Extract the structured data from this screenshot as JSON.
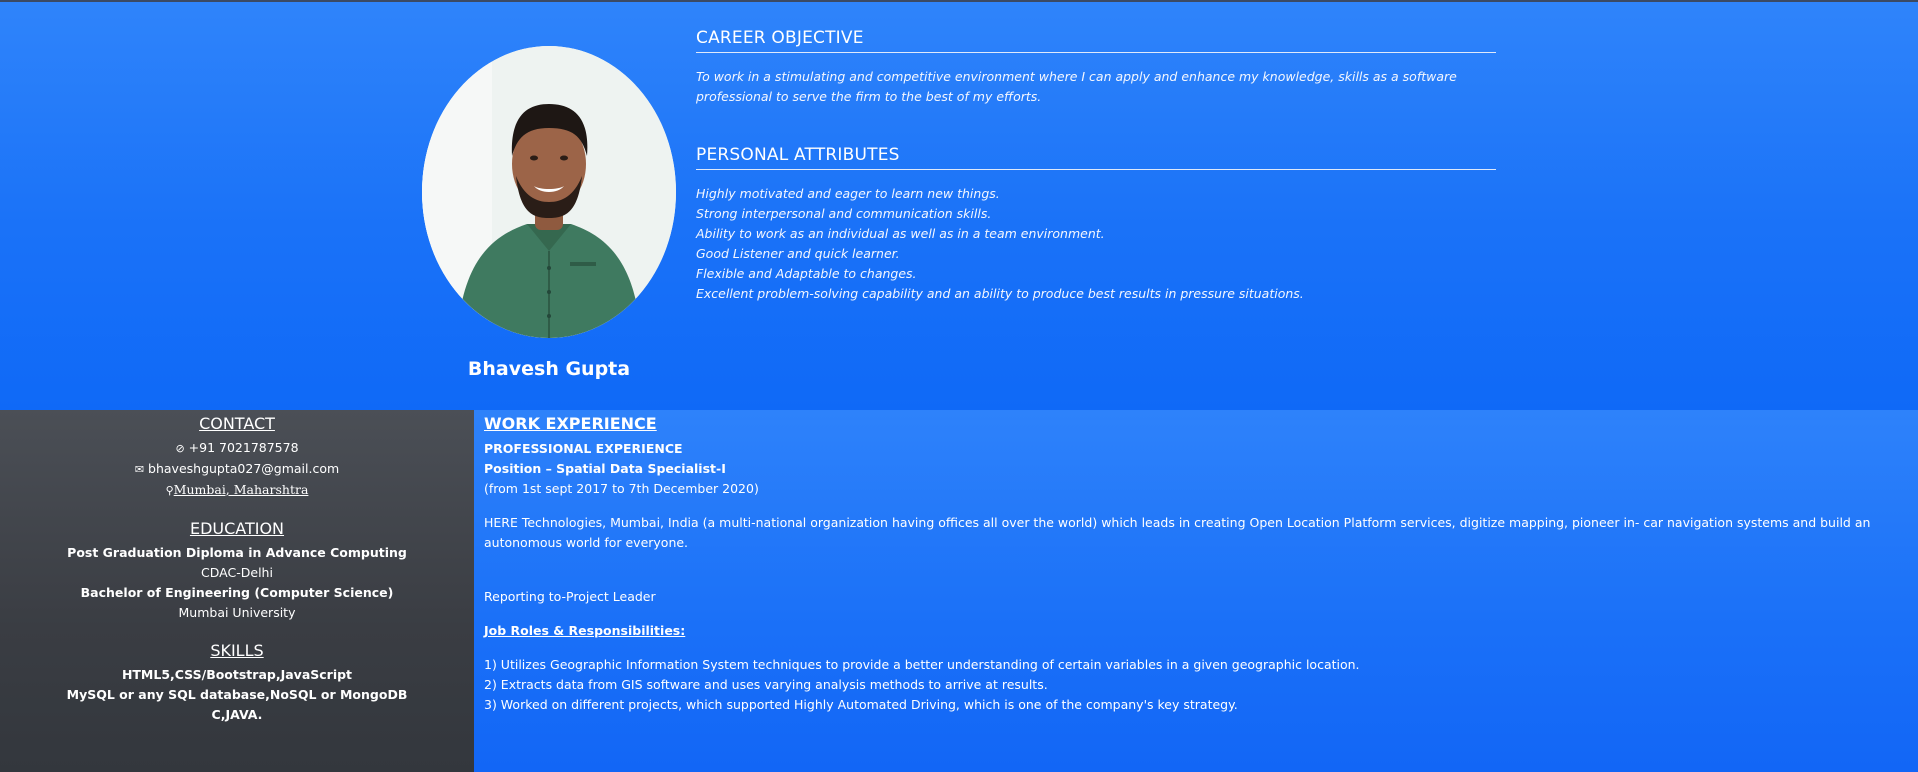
{
  "profile": {
    "name": "Bhavesh Gupta"
  },
  "career": {
    "title": "CAREER OBJECTIVE",
    "text": "To work in a stimulating and competitive environment where I can apply and enhance my knowledge, skills as a software professional to serve the firm to the best of my efforts."
  },
  "attributes": {
    "title": "PERSONAL ATTRIBUTES",
    "items": [
      "Highly motivated and eager to learn new things.",
      "Strong interpersonal and communication skills.",
      "Ability to work as an individual as well as in a team environment.",
      "Good Listener and quick learner.",
      "Flexible and Adaptable to changes.",
      "Excellent problem-solving capability and an ability to produce best results in pressure situations."
    ]
  },
  "contact": {
    "title": "CONTACT",
    "phone": "+91 7021787578",
    "email": "bhaveshgupta027@gmail.com",
    "location": "Mumbai, Maharshtra"
  },
  "education": {
    "title": "EDUCATION",
    "degree1": "Post Graduation Diploma in Advance Computing",
    "school1": "CDAC-Delhi",
    "degree2": "Bachelor of Engineering (Computer Science)",
    "school2": "Mumbai University"
  },
  "skills": {
    "title": "SKILLS",
    "items": [
      "HTML5,CSS/Bootstrap,JavaScript",
      "MySQL or any SQL database,NoSQL or MongoDB",
      "C,JAVA."
    ]
  },
  "work": {
    "title": "WORK EXPERIENCE",
    "subtitle": "PROFESSIONAL EXPERIENCE",
    "position": "Position – Spatial Data Specialist-I",
    "period": "(from 1st sept 2017 to 7th December 2020)",
    "company_desc": "HERE Technologies, Mumbai, India (a multi-national organization having offices all over the world) which leads in creating Open Location Platform services, digitize mapping, pioneer in- car navigation systems and build an autonomous world for everyone.",
    "reporting": "Reporting to-Project Leader",
    "roles_title": "Job Roles & Responsibilities:",
    "roles": [
      "1) Utilizes Geographic Information System techniques to provide a better understanding of certain variables in a given geographic location.",
      "2) Extracts data from GIS software and uses varying analysis methods to arrive at results.",
      "3) Worked on different projects, which supported Highly Automated Driving, which is one of the company's key strategy."
    ]
  },
  "icons": {
    "phone": "phone-icon",
    "email": "email-icon",
    "location": "location-pin-icon"
  }
}
